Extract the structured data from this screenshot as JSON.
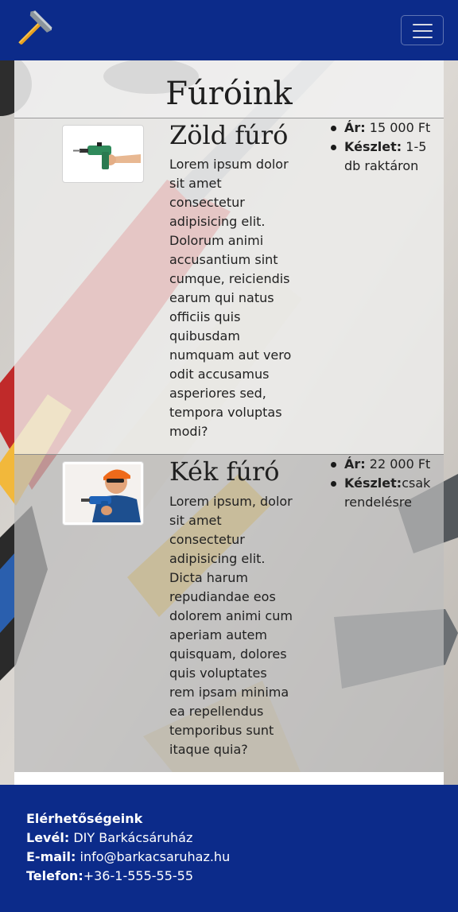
{
  "navbar": {
    "logo_icon": "hammer-icon",
    "menu_icon": "hamburger-menu-icon",
    "bg_color": "#0c2b8a"
  },
  "page": {
    "title": "Fúróink"
  },
  "products": [
    {
      "name": "Zöld fúró",
      "image_icon": "green-drill-image",
      "description": "Lorem ipsum dolor sit amet consectetur adipisicing elit. Dolorum animi accusantium sint cumque, reiciendis earum qui natus officiis quis quibusdam numquam aut vero odit accusamus asperiores sed, tempora voluptas modi?",
      "price_label": "Ár:",
      "price_value": "15 000 Ft",
      "stock_label": "Készlet:",
      "stock_value": "1-5 db raktáron"
    },
    {
      "name": "Kék fúró",
      "image_icon": "blue-drill-image",
      "description": "Lorem ipsum, dolor sit amet consectetur adipisicing elit. Dicta harum repudiandae eos dolorem animi cum aperiam autem quisquam, dolores quis voluptates rem ipsam minima ea repellendus temporibus sunt itaque quia?",
      "price_label": "Ár:",
      "price_value": "22 000 Ft",
      "stock_label": "Készlet:",
      "stock_value": "csak rendelésre"
    }
  ],
  "footer": {
    "heading": "Elérhetőségeink",
    "letter_label": "Levél:",
    "letter_value": "DIY Barkácsáruház",
    "email_label": "E-mail:",
    "email_value": "info@barkacsaruhaz.hu",
    "phone_label": "Telefon:",
    "phone_value": "+36-1-555-55-55",
    "bg_color": "#0c2b8a"
  }
}
